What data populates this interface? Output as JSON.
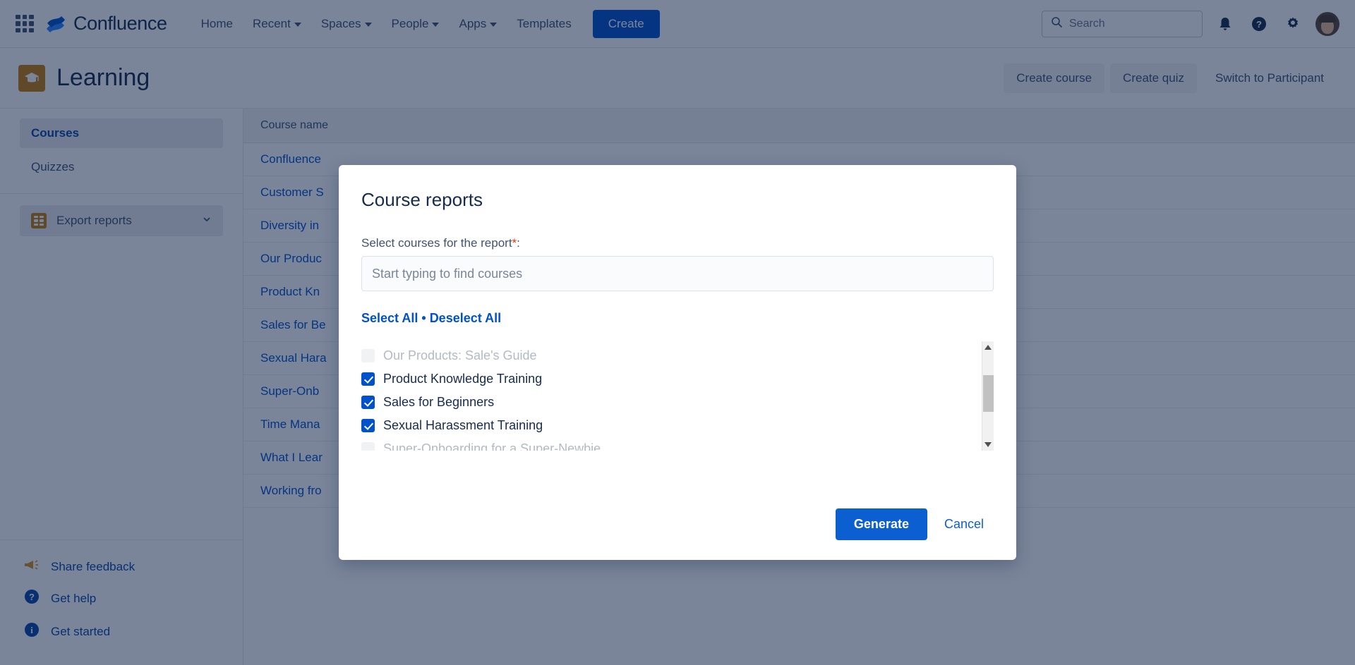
{
  "topnav": {
    "app_grid_icon": "app-switcher-grid-icon",
    "brand": "Confluence",
    "links": [
      {
        "label": "Home",
        "has_caret": false
      },
      {
        "label": "Recent",
        "has_caret": true
      },
      {
        "label": "Spaces",
        "has_caret": true
      },
      {
        "label": "People",
        "has_caret": true
      },
      {
        "label": "Apps",
        "has_caret": true
      },
      {
        "label": "Templates",
        "has_caret": false
      }
    ],
    "create_label": "Create",
    "search_placeholder": "Search",
    "icons": [
      "notification-bell-icon",
      "help-icon",
      "settings-gear-icon",
      "avatar"
    ]
  },
  "space": {
    "title": "Learning",
    "logo_icon": "graduation-cap-icon",
    "logo_color": "#c47d0a",
    "actions": [
      {
        "label": "Create course",
        "style": "ghost"
      },
      {
        "label": "Create quiz",
        "style": "ghost"
      },
      {
        "label": "Switch to Participant",
        "style": "plain"
      }
    ]
  },
  "sidebar": {
    "items": [
      {
        "label": "Courses",
        "selected": true
      },
      {
        "label": "Quizzes",
        "selected": false
      }
    ],
    "export_group": {
      "label": "Export reports",
      "icon": "table-grid-icon",
      "chevron": "chevron-down-icon"
    },
    "bottom_links": [
      {
        "label": "Share feedback",
        "icon": "megaphone-icon"
      },
      {
        "label": "Get help",
        "icon": "help-circle-icon"
      },
      {
        "label": "Get started",
        "icon": "info-circle-icon"
      }
    ]
  },
  "table": {
    "columns": [
      "Course name"
    ],
    "rows": [
      "Confluence",
      "Customer S",
      "Diversity in",
      "Our Produc",
      "Product Kn",
      "Sales for Be",
      "Sexual Hara",
      "Super-Onb",
      "Time Mana",
      "What I Lear",
      "Working fro"
    ]
  },
  "modal": {
    "title": "Course reports",
    "field_label": "Select courses for the report",
    "required_mark": "*",
    "label_colon": ":",
    "input_value": "",
    "input_placeholder": "Start typing to find courses",
    "select_all": "Select All",
    "separator": "•",
    "deselect_all": "Deselect All",
    "courses": [
      {
        "label": "Our Products: Sale's Guide",
        "checked": false,
        "disabled": true
      },
      {
        "label": "Product Knowledge Training",
        "checked": true,
        "disabled": false
      },
      {
        "label": "Sales for Beginners",
        "checked": true,
        "disabled": false
      },
      {
        "label": "Sexual Harassment Training",
        "checked": true,
        "disabled": false
      },
      {
        "label": "Super-Onboarding for a Super-Newbie",
        "checked": false,
        "disabled": true
      }
    ],
    "generate_label": "Generate",
    "cancel_label": "Cancel",
    "accent_color": "#0c5fd1"
  }
}
